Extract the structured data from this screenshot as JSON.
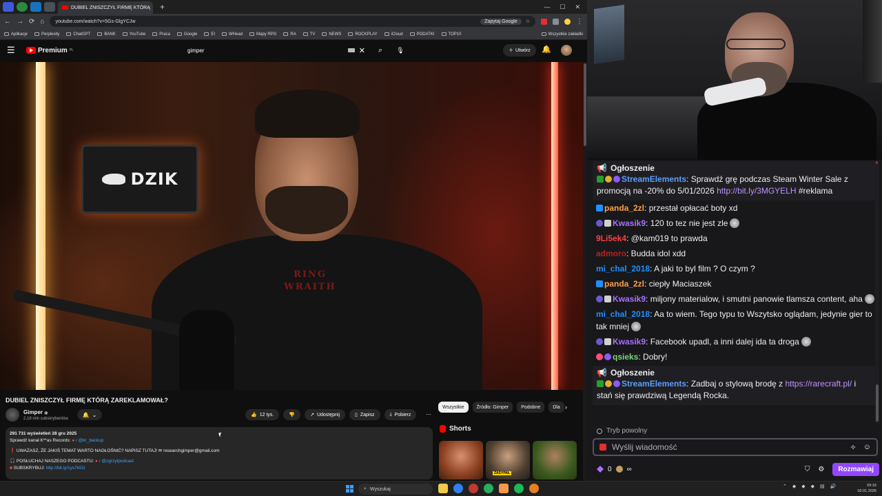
{
  "browser": {
    "tab_title": "DUBIEL ZNISZCZYŁ FIRMĘ KTÓRĄ",
    "tab_close": "✕",
    "new_tab": "+",
    "window_controls": [
      "—",
      "☐",
      "✕"
    ],
    "nav_icons": [
      "←",
      "→",
      "⟳",
      "⌂"
    ],
    "url": "youtube.com/watch?v=5Gs-GlgYCJw",
    "google_button": "Zapytaj Google",
    "bookmarks": [
      "Aplikacje",
      "Perplexity",
      "ChatGPT",
      "BANK",
      "YouTube",
      "Praca",
      "Google",
      "EI",
      "WHead",
      "Mapy RPG",
      "RA",
      "TV",
      "NEWS",
      "ROCKPLAY",
      "iCloud",
      "PODATKI",
      "TOP10"
    ],
    "bookmarks_right": "Wszystkie zakładki"
  },
  "youtube": {
    "logo": "Premium",
    "logo_region": "PL",
    "search_query": "gimper",
    "create_label": "Utwórz",
    "video_sign": "DZIK",
    "shirt_text": "RING WRAITH",
    "video_title": "DUBIEL ZNISZCZYŁ FIRMĘ KTÓRĄ ZAREKLAMOWAŁ?",
    "channel_name": "Gimper",
    "channel_subs": "2,18 mln subskrybentów",
    "likes": "12 tys.",
    "share": "Udostępnij",
    "save": "Zapisz",
    "download": "Pobierz",
    "more": "⋯",
    "description": {
      "stats": "291 731 wyświetleń  28 gru 2025",
      "line1_prefix": "Sprawdź kanał K**as Records:",
      "line1_handle": "/ @kr_backup",
      "line2_prefix": "❗ UWAŻASZ, ŻE JAKIŚ TEMAT WARTO NAGŁOŚNIĆ? NAPISZ TUTAJ!",
      "line2_email": "researchgimper@gmail.com",
      "line3_prefix": "🎧 POSŁUCHAJ NASZEGO PODCASTU:",
      "line3_handle": "/ @zgrzytpodcast",
      "line4_prefix": "SUBSKRYBUJ:",
      "line4_link": "http://bit.ly/1ys7k5G"
    },
    "chips": [
      "Wszystkie",
      "Źródło: Gimper",
      "Podobne",
      "Dla"
    ],
    "shorts_title": "Shorts",
    "short_label": "ZASYPAŁ"
  },
  "chat": {
    "announcement_label": "Ogłoszenie",
    "ann1": {
      "user": "StreamElements",
      "text": ": Sprawdź grę podczas Steam Winter Sale z promocją na -20% do 5/01/2026 ",
      "link": "http://bit.ly/3MGYELH",
      "suffix": " #reklama"
    },
    "messages": [
      {
        "user": "panda_2zl",
        "color": "#ff9f43",
        "text": ": przestał opłacać boty xd"
      },
      {
        "user": "Kwasik9",
        "color": "#a970ff",
        "text": ": 120 to tez nie jest zle"
      },
      {
        "user": "9Li5ek4",
        "color": "#ff4040",
        "text": ": @kam019 to prawda"
      },
      {
        "user": "admoro",
        "color": "#b22222",
        "text": ": Budda idol xdd"
      },
      {
        "user": "mi_chal_2018",
        "color": "#1e90ff",
        "text": ": A jaki to byl film ? O czym ?"
      },
      {
        "user": "panda_2zl",
        "color": "#ff9f43",
        "text": ": ciepły Maciaszek"
      },
      {
        "user": "Kwasik9",
        "color": "#a970ff",
        "text": ": miljony materialow, i smutni panowie tlamsza content, aha"
      },
      {
        "user": "mi_chal_2018",
        "color": "#1e90ff",
        "text": ": Aa to wiem. Tego typu to Wszytsko oglądam, jedynie gier to tak mniej"
      },
      {
        "user": "Kwasik9",
        "color": "#a970ff",
        "text": ": Facebook upadl, a inni dalej ida ta droga"
      },
      {
        "user": "qsieks",
        "color": "#7cd67c",
        "text": ": Dobry!"
      }
    ],
    "ann2": {
      "user": "StreamElements",
      "text": ": Zadbaj o stylową brodę z ",
      "link": "https://rarecraft.pl/",
      "suffix": " i stań się prawdziwą Legendą Rocka."
    },
    "mode_label": "Tryb powolny",
    "input_placeholder": "Wyślij wiadomość",
    "points": "0",
    "infinity": "∞",
    "send_label": "Rozmawiaj"
  },
  "taskbar": {
    "search_placeholder": "Wyszukaj",
    "time": "09:16",
    "date": "02.01.2026"
  }
}
